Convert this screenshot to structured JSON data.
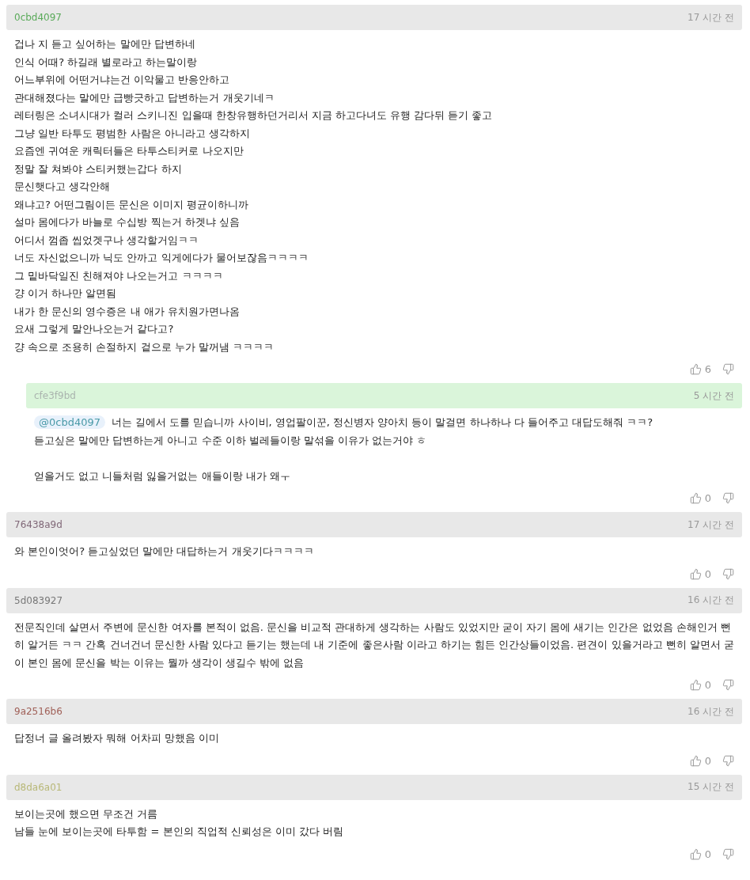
{
  "comments": [
    {
      "kind": "comment",
      "author": "0cbd4097",
      "color": "#5aaa5a",
      "time": "17 시간 전",
      "paragraphs": [
        [
          "겁나 지 듣고 싶어하는 말에만 답변하네",
          "인식 어때? 하길래 별로라고 하는말이랑",
          "어느부위에 어떤거냐는건 이악물고 반응안하고",
          "관대해졌다는 말에만 급빵긋하고 답변하는거 개웃기네ㅋ",
          "레터링은 소녀시대가 컬러 스키니진 입을때 한창유행하던거리서 지금 하고다녀도 유행 감다뒤 듣기 좋고",
          "그냥 일반 타투도 평범한 사람은 아니라고 생각하지",
          "요즘엔 귀여운 캐릭터들은 타투스티커로 나오지만",
          "정말 잘 쳐봐야 스티커했는갑다 하지",
          "문신햇다고 생각안해",
          "왜냐고? 어떤그림이든 문신은 이미지 평균이하니까",
          "설마 몸에다가 바늘로 수십방 찍는거 하겟냐 싶음",
          "어디서 껌좁 씹었겟구나 생각할거임ㅋㅋ",
          "너도 자신없으니까 닉도 안까고 익게에다가 물어보잖음ㅋㅋㅋㅋ",
          "그 밑바닥일진 친해져야 나오는거고 ㅋㅋㅋㅋ",
          "걍 이거 하나만 알면됨",
          "내가 한 문신의 영수증은 내 애가 유치원가면나옴",
          "요새 그렇게 말안나오는거 같다고?",
          "걍 속으로 조용히 손절하지 겉으로 누가 말꺼냄 ㅋㅋㅋㅋ"
        ]
      ],
      "likes": "6"
    },
    {
      "kind": "reply",
      "author": "cfe3f9bd",
      "color": "#aab4ae",
      "time": "5 시간 전",
      "mention": "@0cbd4097",
      "paragraphs": [
        [
          "너는 길에서 도를 믿습니까 사이비, 영업팔이꾼, 정신병자 양아치 등이 말걸면 하나하나 다 들어주고 대답도해줘 ㅋㅋ?",
          "듣고싶은 말에만 답변하는게 아니고 수준 이하 벌레들이랑 말섞을 이유가 없는거야 ㅎ"
        ],
        [
          "얻을거도 없고 니들처럼 잃을거없는 애들이랑 내가 왜ㅜ"
        ]
      ],
      "likes": "0"
    },
    {
      "kind": "comment",
      "author": "76438a9d",
      "color": "#806878",
      "time": "17 시간 전",
      "paragraphs": [
        [
          "와 본인이엇어? 듣고싶었던 말에만 대답하는거 개웃기다ㅋㅋㅋㅋ"
        ]
      ],
      "likes": "0"
    },
    {
      "kind": "comment",
      "author": "5d083927",
      "color": "#787878",
      "time": "16 시간 전",
      "paragraphs": [
        [
          "전문직인데 살면서 주변에 문신한 여자를 본적이 없음. 문신을 비교적 관대하게 생각하는 사람도 있었지만 굳이 자기 몸에 새기는 인간은 없었음 손해인거 뻔히 알거든 ㅋㅋ 간혹 건너건너 문신한 사람 있다고 듣기는 했는데 내 기준에 좋은사람 이라고 하기는 힘든 인간상들이었음. 편견이 있을거라고 뻔히 알면서 굳이 본인 몸에 문신을 박는 이유는 뭘까 생각이 생길수 밖에 없음"
        ]
      ],
      "likes": "0"
    },
    {
      "kind": "comment",
      "author": "9a2516b6",
      "color": "#a06058",
      "time": "16 시간 전",
      "paragraphs": [
        [
          "답정너 글 올려봤자 뭐해 어차피 망했음 이미"
        ]
      ],
      "likes": "0"
    },
    {
      "kind": "comment",
      "author": "d8da6a01",
      "color": "#b8b878",
      "time": "15 시간 전",
      "paragraphs": [
        [
          "보이는곳에 했으면 무조건 거름",
          "남들 눈에 보이는곳에 타투함 = 본인의 직업적 신뢰성은 이미 갔다 버림"
        ]
      ],
      "likes": "0"
    }
  ]
}
